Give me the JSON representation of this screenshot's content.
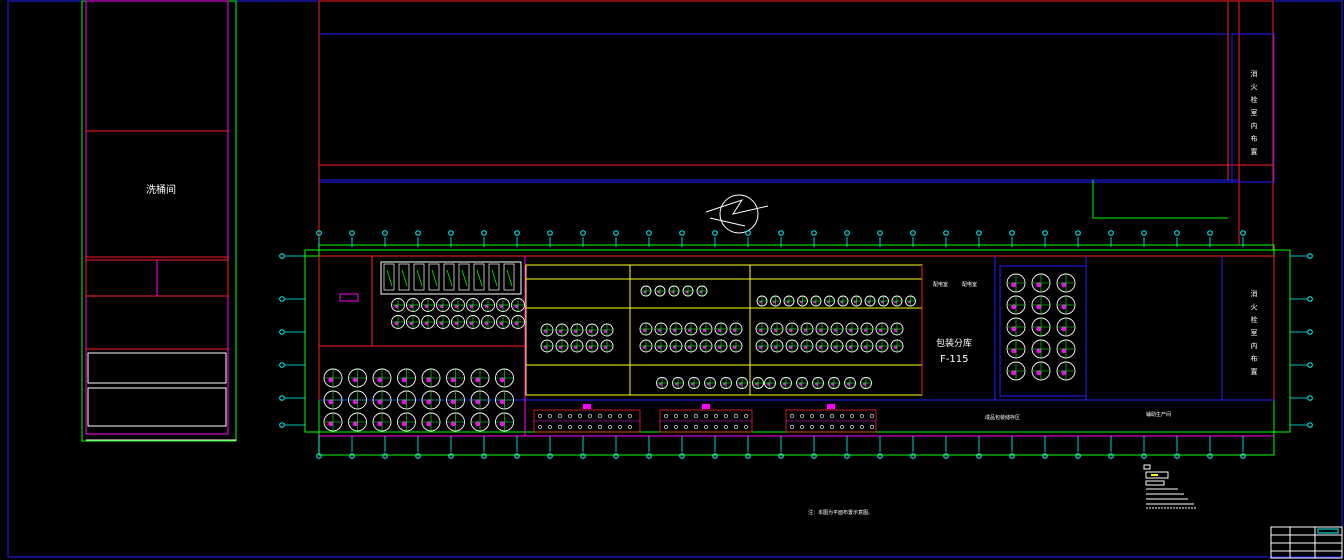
{
  "colors": {
    "background": "#000000",
    "frame": "#2020ff",
    "wall": "#ff2020",
    "partition": "#ff00ff",
    "outline": "#00ff00",
    "axis": "#00ffff",
    "yellow": "#ffff00",
    "label": "#ffffff"
  },
  "labels": {
    "wash_room": "洗桶间",
    "workshop_name": "包装分库",
    "workshop_code": "F-115",
    "vertical_note_a": "消火栓室内布置",
    "vertical_note_b": "消火栓室内布置",
    "room_small_1": "配电室",
    "room_small_2": "配电室",
    "bottom_label_1": "成品包装储存区",
    "bottom_label_2": "辅助生产间",
    "note": "注：本图为平面布置示意图。"
  }
}
